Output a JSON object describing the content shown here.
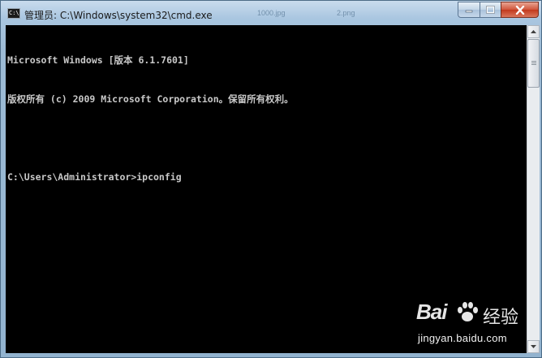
{
  "window": {
    "title": "管理员: C:\\Windows\\system32\\cmd.exe",
    "icon_text": "C:\\"
  },
  "background_thumbnails": [
    "1000.jpg",
    "2.png"
  ],
  "controls": {
    "minimize_icon": "minimize-icon",
    "maximize_icon": "maximize-icon",
    "close_icon": "close-icon"
  },
  "console": {
    "lines": [
      "Microsoft Windows [版本 6.1.7601]",
      "版权所有 (c) 2009 Microsoft Corporation。保留所有权利。",
      "",
      "C:\\Users\\Administrator>ipconfig"
    ],
    "background": "#000000",
    "foreground": "#c8c8c8"
  },
  "watermark": {
    "logo": "Bai",
    "logo_suffix": "经验",
    "url": "jingyan.baidu.com"
  }
}
